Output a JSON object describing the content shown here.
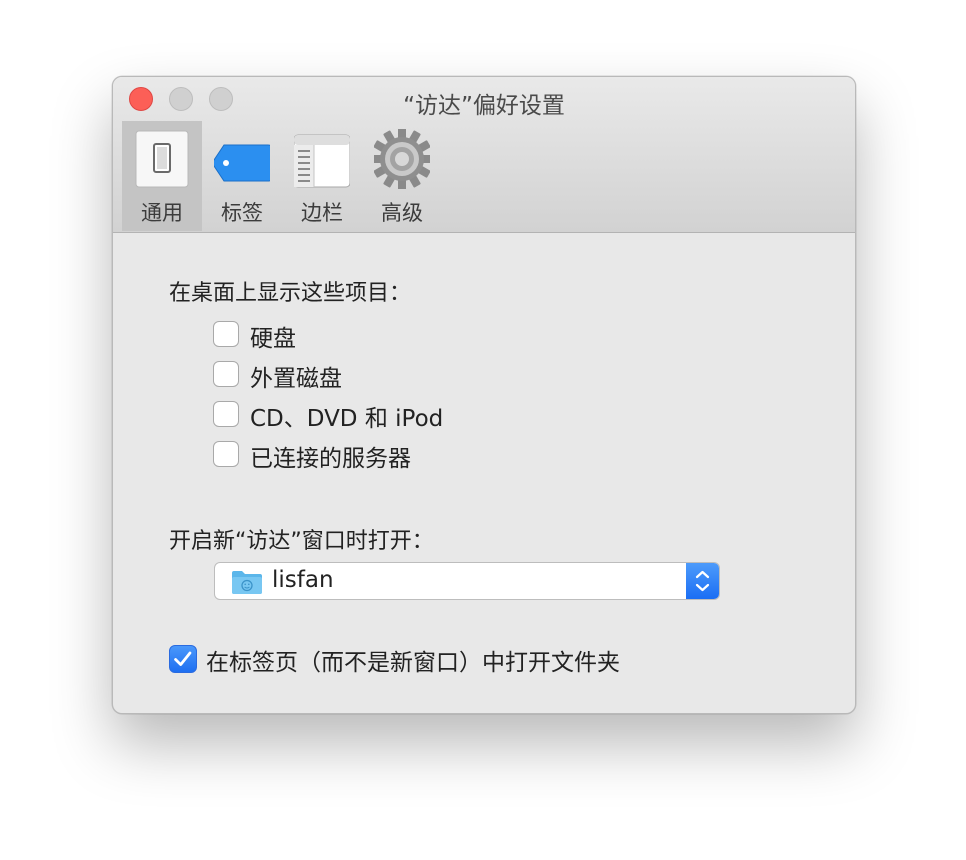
{
  "window": {
    "title": "“访达”偏好设置"
  },
  "toolbar": {
    "tabs": [
      {
        "label": "通用",
        "icon": "general-switch-icon",
        "selected": true
      },
      {
        "label": "标签",
        "icon": "tag-icon",
        "selected": false
      },
      {
        "label": "边栏",
        "icon": "sidebar-icon",
        "selected": false
      },
      {
        "label": "高级",
        "icon": "gear-icon",
        "selected": false
      }
    ]
  },
  "desktop_items": {
    "label": "在桌面上显示这些项目：",
    "items": [
      {
        "label": "硬盘",
        "checked": false
      },
      {
        "label": "外置磁盘",
        "checked": false
      },
      {
        "label": "CD、DVD 和 iPod",
        "checked": false
      },
      {
        "label": "已连接的服务器",
        "checked": false
      }
    ]
  },
  "new_window": {
    "label": "开启新“访达”窗口时打开：",
    "selected": "lisfan",
    "icon": "home-folder-icon"
  },
  "open_in_tabs": {
    "label": "在标签页（而不是新窗口）中打开文件夹",
    "checked": true
  },
  "colors": {
    "accent": "#1e6ff1",
    "close": "#fc5f57",
    "window_bg": "#e8e8e8"
  }
}
